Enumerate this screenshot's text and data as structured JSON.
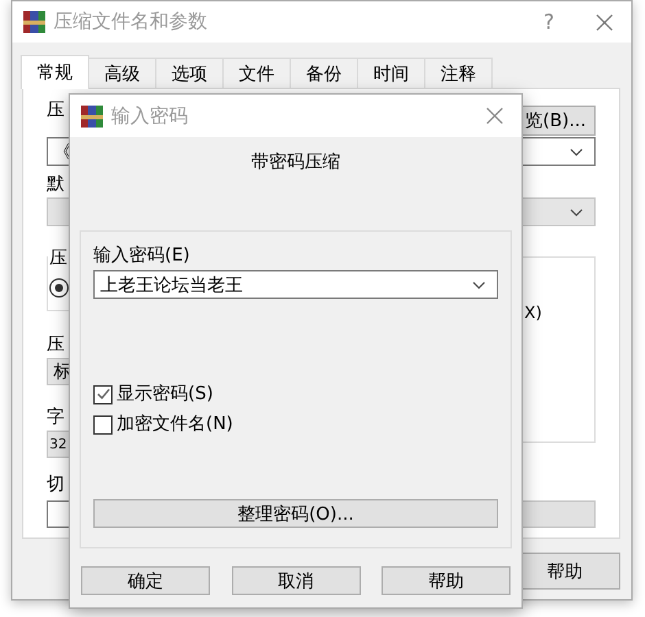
{
  "main_window": {
    "title": "压缩文件名和参数",
    "help_mark": "?"
  },
  "tabs": [
    {
      "label": "常规",
      "selected": true
    },
    {
      "label": "高级",
      "selected": false
    },
    {
      "label": "选项",
      "selected": false
    },
    {
      "label": "文件",
      "selected": false
    },
    {
      "label": "备份",
      "selected": false
    },
    {
      "label": "时间",
      "selected": false
    },
    {
      "label": "注释",
      "selected": false
    }
  ],
  "general": {
    "archive_name_label": "压",
    "browse_button": "览(B)...",
    "archive_name_value": "《",
    "profile_label": "默",
    "format_group_label": "压",
    "format_radio_selected": true,
    "option_partial": "X)",
    "method_label": "压",
    "method_value": "标",
    "dictionary_label": "字",
    "dictionary_value": "32",
    "split_label": "切"
  },
  "help_button": "帮助",
  "password_dialog": {
    "title": "输入密码",
    "heading": "带密码压缩",
    "password_label": "输入密码(E)",
    "password_value": "上老王论坛当老王",
    "checkboxes": [
      {
        "label": "显示密码(S)",
        "checked": true
      },
      {
        "label": "加密文件名(N)",
        "checked": false
      }
    ],
    "organize_button": "整理密码(O)...",
    "buttons": [
      "确定",
      "取消",
      "帮助"
    ]
  }
}
